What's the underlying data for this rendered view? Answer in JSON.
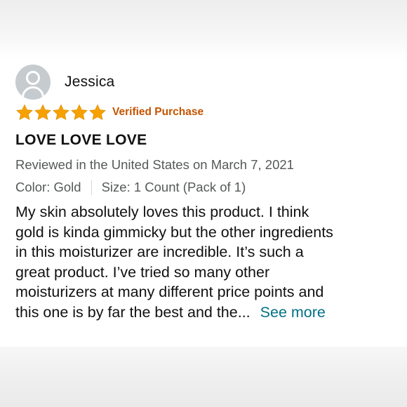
{
  "review": {
    "reviewer_name": "Jessica",
    "rating": 5,
    "rating_max": 5,
    "verified_label": "Verified Purchase",
    "title": "LOVE LOVE LOVE",
    "review_meta": "Reviewed in the United States on March 7, 2021",
    "color_variant": "Color: Gold",
    "size_variant": "Size: 1 Count (Pack of 1)",
    "body_lines": [
      "My skin absolutely loves this product. I think",
      "gold is kinda gimmicky but the other ingredients",
      "in this moisturizer are incredible. It’s such a",
      "great product. I’ve tried so many other",
      "moisturizers at many different price points and",
      "this one is by far the best and the..."
    ],
    "see_more_label": "See more"
  },
  "colors": {
    "star": "#f7a100",
    "verified": "#c45500",
    "link": "#007185",
    "meta_text": "#565959",
    "avatar_bg": "#c6cbcf"
  },
  "icons": {
    "avatar": "user-avatar-icon",
    "star": "star-icon"
  }
}
